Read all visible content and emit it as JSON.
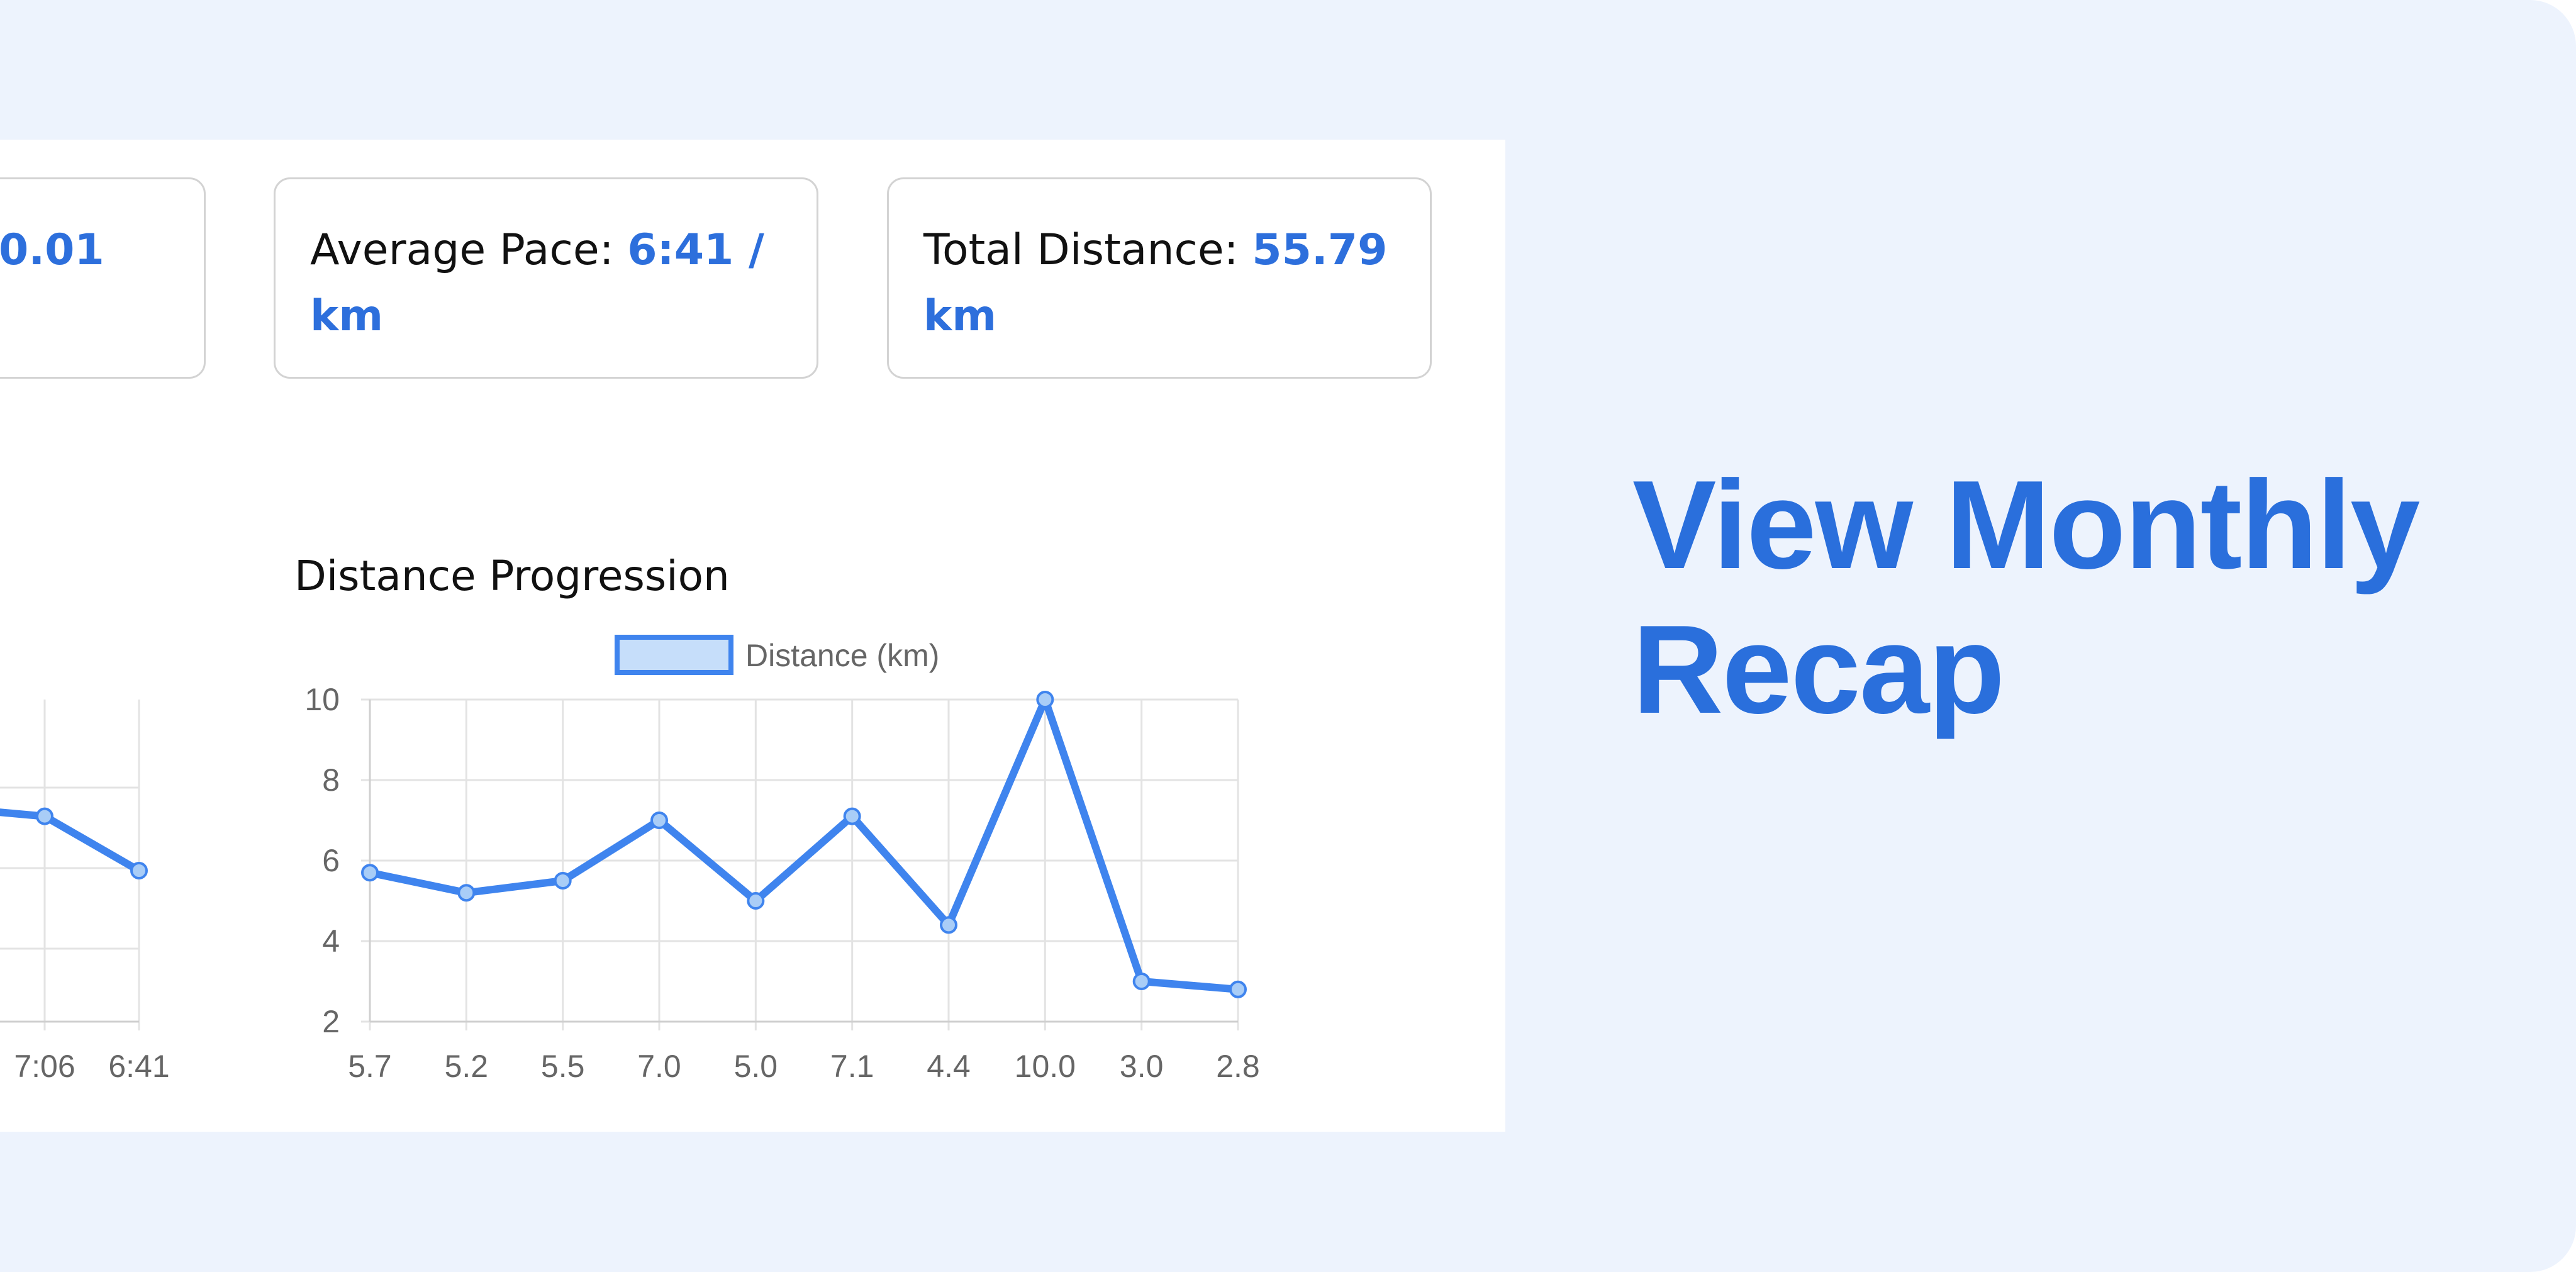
{
  "cards": {
    "fastest": {
      "value": "0.01"
    },
    "pace": {
      "label": "Average Pace: ",
      "value": "6:41 / km"
    },
    "distance": {
      "label": "Total Distance: ",
      "value": "55.79 km"
    }
  },
  "headline": "View Monthly Recap",
  "colors": {
    "accent": "#2a6fdc",
    "line": "#3f84ee",
    "point_fill": "#a9cdf7",
    "background": "#edf3fd"
  },
  "chart_data": [
    {
      "type": "line",
      "title": "Distance Progression",
      "legend": {
        "label": "Distance (km)",
        "placement": "top-center"
      },
      "categories": [
        "5.7",
        "5.2",
        "5.5",
        "7.0",
        "5.0",
        "7.1",
        "4.4",
        "10.0",
        "3.0",
        "2.8"
      ],
      "series": [
        {
          "name": "Distance (km)",
          "values": [
            5.7,
            5.2,
            5.5,
            7.0,
            5.0,
            7.1,
            4.4,
            10.0,
            3.0,
            2.8
          ]
        }
      ],
      "y_ticks": [
        "2",
        "4",
        "6",
        "8",
        "10"
      ],
      "ylim": [
        2,
        10
      ],
      "grid": true
    },
    {
      "type": "line",
      "partial": true,
      "categories": [
        "7:06",
        "6:41"
      ],
      "series": [
        {
          "values": [
            7.1,
            5.75
          ]
        }
      ],
      "grid": true
    }
  ]
}
